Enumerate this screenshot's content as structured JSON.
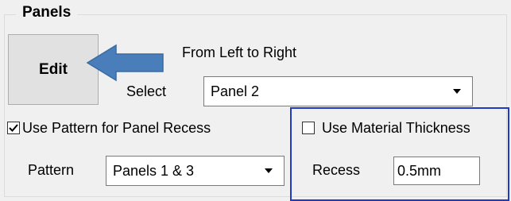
{
  "group": {
    "title": "Panels"
  },
  "edit_button": {
    "label": "Edit"
  },
  "direction_label": "From Left to Right",
  "select": {
    "label": "Select",
    "value": "Panel 2"
  },
  "use_pattern": {
    "label": "Use Pattern for Panel Recess",
    "checked": true
  },
  "pattern": {
    "label": "Pattern",
    "value": "Panels 1 & 3"
  },
  "use_material_thickness": {
    "label": "Use Material Thickness",
    "checked": false
  },
  "recess": {
    "label": "Recess",
    "value": "0.5mm"
  },
  "colors": {
    "arrow": "#4a7ebb",
    "highlight_border": "#1f3ac4"
  },
  "icons": {
    "arrow": "left-arrow-icon",
    "checkmark": "checkmark-icon"
  }
}
